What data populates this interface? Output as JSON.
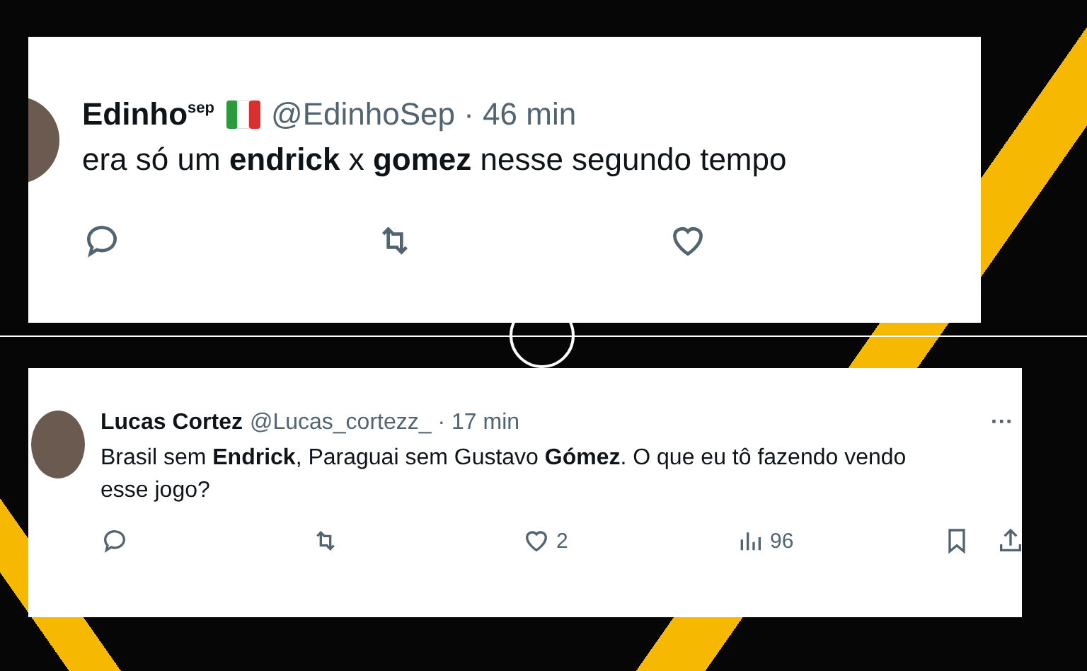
{
  "tweets": [
    {
      "kind": "large",
      "author": "Edinho$^{sep}$",
      "flag": true,
      "meta": "@EdinhoSep · 46 min",
      "text": "era só um **endrick** x **gomez** nesse segundo tempo",
      "actions": [
        {
          "kind": "reply"
        },
        {
          "kind": "retweet"
        },
        {
          "kind": "like"
        }
      ]
    },
    {
      "kind": "small",
      "author": "Lucas Cortez",
      "meta": "@Lucas_cortezz_ · 17 min",
      "more": "···",
      "text": "Brasil sem **Endrick**, Paraguai sem Gustavo **Gómez**. O que eu tô fazendo vendo esse jogo?",
      "actions": [
        {
          "kind": "reply"
        },
        {
          "kind": "retweet"
        },
        {
          "kind": "like",
          "count": "2"
        },
        {
          "kind": "views",
          "count": "96"
        },
        {
          "kind": "bookmark"
        },
        {
          "kind": "share"
        }
      ]
    }
  ]
}
